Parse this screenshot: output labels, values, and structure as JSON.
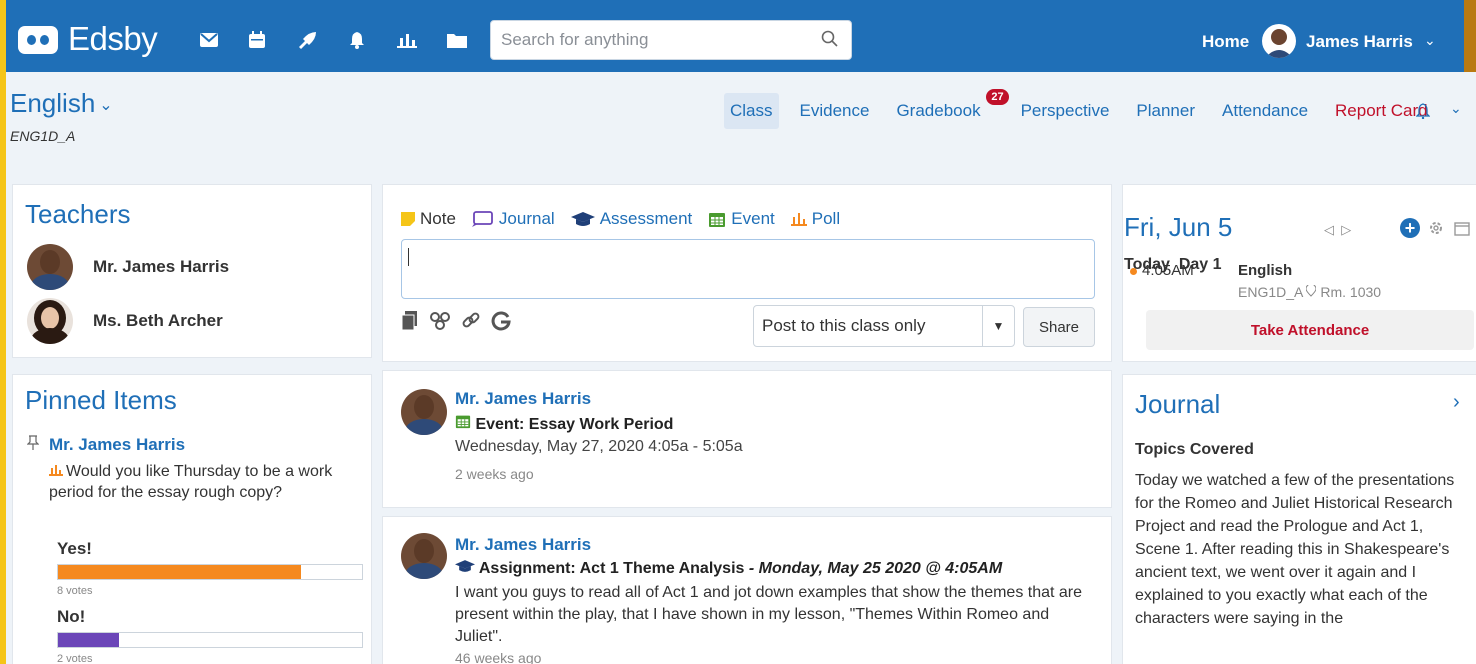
{
  "app": {
    "name": "Edsby"
  },
  "topbar": {
    "search_placeholder": "Search for anything",
    "home_label": "Home",
    "user_name": "James Harris"
  },
  "colors": {
    "brand": "#1f6fb7",
    "accent_red": "#c0102a",
    "poll_yes": "#f5891f",
    "poll_no": "#6b46b8"
  },
  "class": {
    "title": "English",
    "code": "ENG1D_A"
  },
  "tabs": [
    {
      "label": "Class",
      "active": true
    },
    {
      "label": "Evidence"
    },
    {
      "label": "Gradebook",
      "badge": "27"
    },
    {
      "label": "Perspective"
    },
    {
      "label": "Planner"
    },
    {
      "label": "Attendance"
    },
    {
      "label": "Report Card",
      "highlight": "red"
    }
  ],
  "teachers": {
    "title": "Teachers",
    "items": [
      {
        "name": "Mr. James Harris"
      },
      {
        "name": "Ms. Beth Archer"
      }
    ]
  },
  "pinned": {
    "title": "Pinned Items",
    "author": "Mr. James Harris",
    "question": "Would you like Thursday to be a work period for the essay rough copy?",
    "options": [
      {
        "label": "Yes!",
        "votes_text": "8 votes",
        "share": 0.8
      },
      {
        "label": "No!",
        "votes_text": "2 votes",
        "share": 0.2
      }
    ]
  },
  "poster": {
    "types": [
      "Note",
      "Journal",
      "Assessment",
      "Event",
      "Poll"
    ],
    "select_value": "Post to this class only",
    "share_label": "Share"
  },
  "feed": [
    {
      "author": "Mr. James Harris",
      "title": "Event: Essay Work Period",
      "date": "Wednesday, May 27, 2020 4:05a - 5:05a",
      "ago": "2 weeks ago"
    },
    {
      "author": "Mr. James Harris",
      "title": "Assignment: Act 1 Theme Analysis",
      "title_suffix": " - Monday, May 25 2020 @ 4:05AM",
      "body": "I want you guys to read all of Act 1 and jot down examples that show the themes that are present within the play, that I have shown in my lesson, \"Themes Within Romeo and Juliet\".",
      "ago": "46 weeks ago"
    }
  ],
  "calendar": {
    "date": "Fri, Jun 5",
    "today": "Today",
    "day": "Day 1",
    "event_time": "4:05AM",
    "event_title": "English",
    "event_code": "ENG1D_A",
    "event_room": "Rm. 1030",
    "take_attendance": "Take Attendance"
  },
  "journal": {
    "title": "Journal",
    "section": "Topics Covered",
    "text": "Today we watched a few of the presentations for the Romeo and Juliet Historical Research Project and read the Prologue and Act 1, Scene 1. After reading this in Shakespeare's ancient text, we went over it again and I explained to you exactly what each of the characters were saying in the"
  }
}
